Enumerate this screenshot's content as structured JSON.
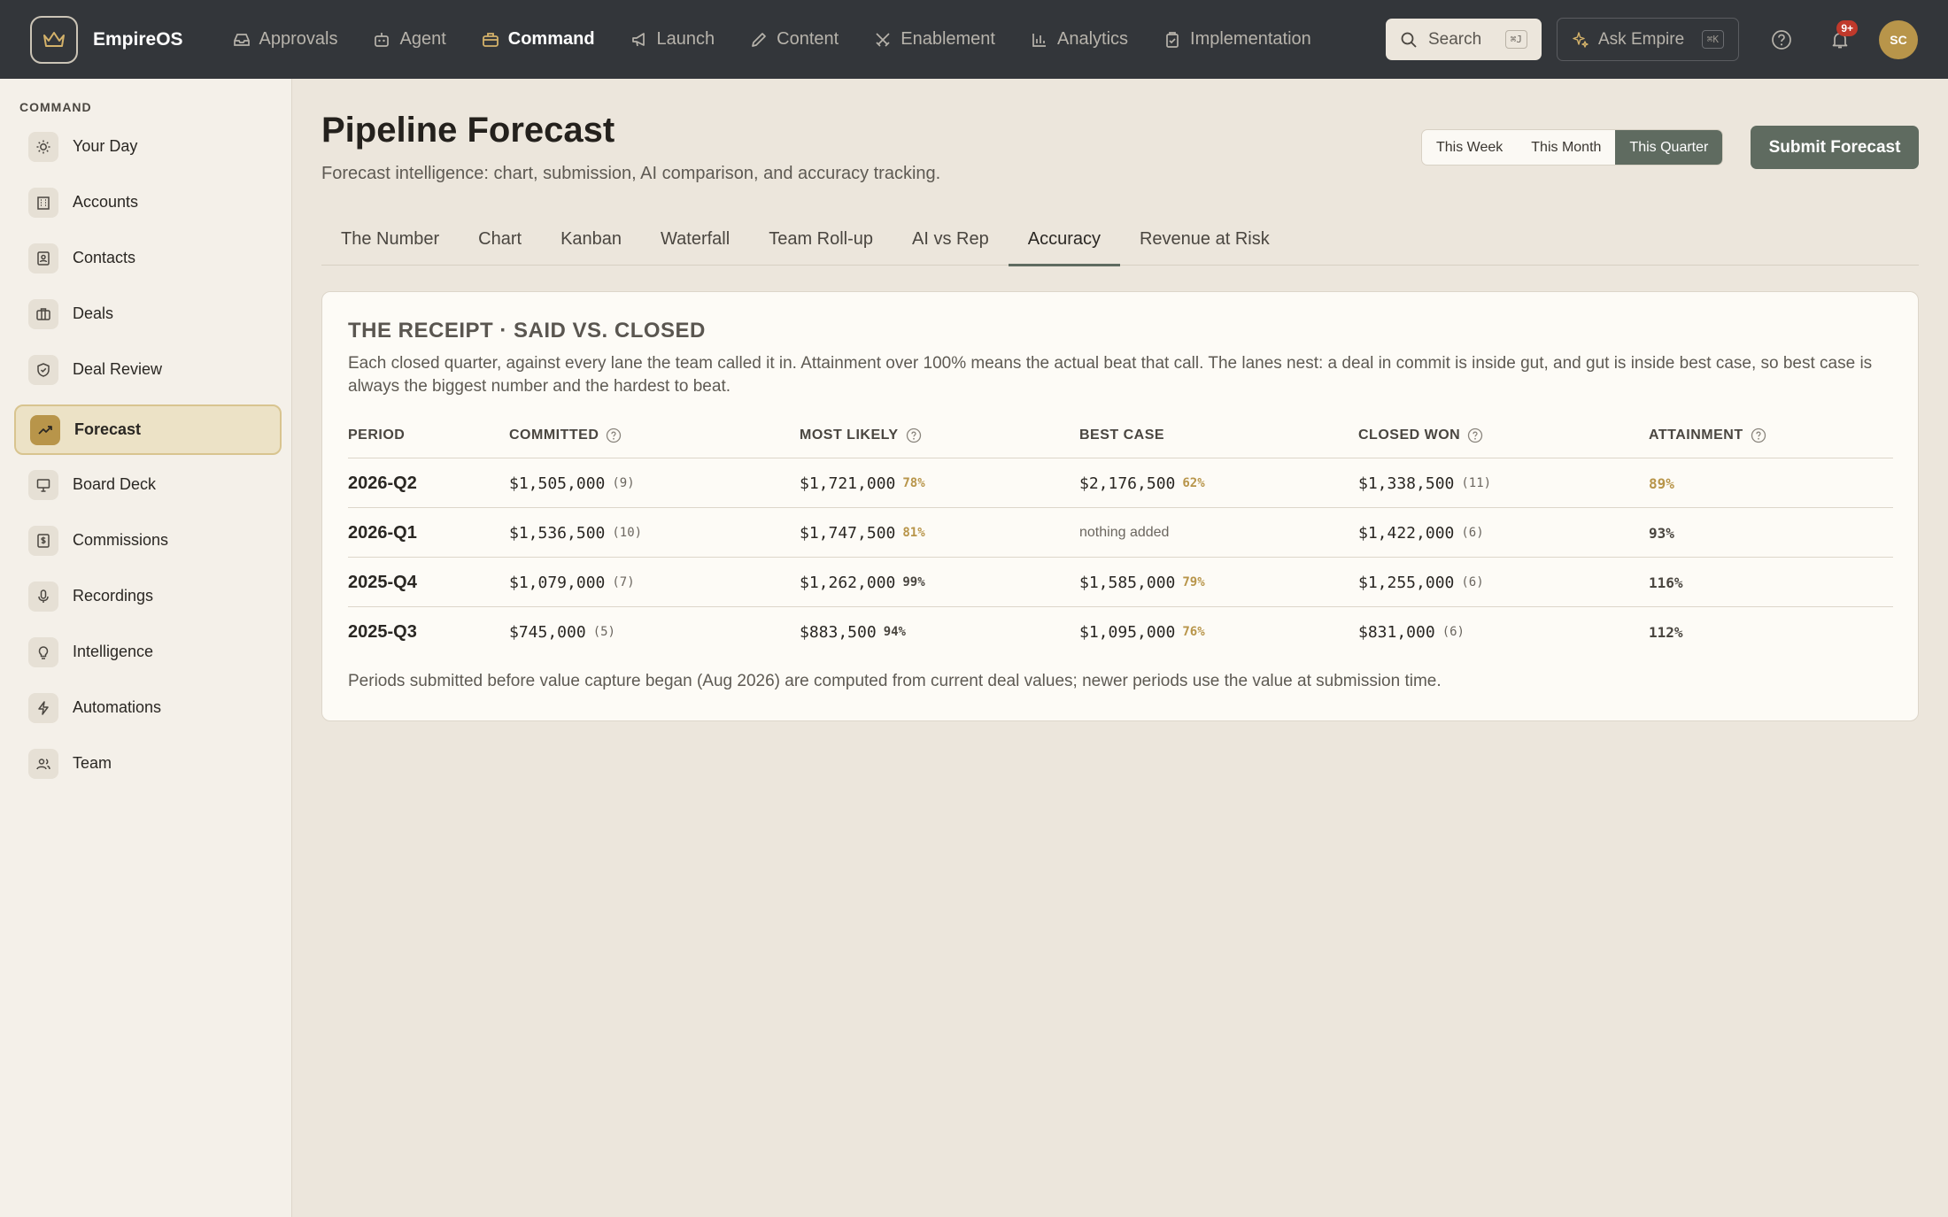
{
  "app": {
    "name": "EmpireOS"
  },
  "topnav": [
    {
      "label": "Approvals",
      "icon": "inbox-icon",
      "active": false
    },
    {
      "label": "Agent",
      "icon": "robot-icon",
      "active": false
    },
    {
      "label": "Command",
      "icon": "briefcase-icon",
      "active": true
    },
    {
      "label": "Launch",
      "icon": "megaphone-icon",
      "active": false
    },
    {
      "label": "Content",
      "icon": "pencil-icon",
      "active": false
    },
    {
      "label": "Enablement",
      "icon": "swords-icon",
      "active": false
    },
    {
      "label": "Analytics",
      "icon": "bar-chart-icon",
      "active": false
    },
    {
      "label": "Implementation",
      "icon": "clipboard-icon",
      "active": false
    }
  ],
  "search": {
    "label": "Search",
    "shortcut": "⌘J"
  },
  "ask": {
    "label": "Ask Empire",
    "shortcut": "⌘K"
  },
  "notifications": {
    "badge": "9+"
  },
  "user": {
    "initials": "SC"
  },
  "sidebar": {
    "section": "COMMAND",
    "items": [
      {
        "label": "Your Day",
        "icon": "sun-icon"
      },
      {
        "label": "Accounts",
        "icon": "building-icon"
      },
      {
        "label": "Contacts",
        "icon": "contact-card-icon"
      },
      {
        "label": "Deals",
        "icon": "briefcase-icon"
      },
      {
        "label": "Deal Review",
        "icon": "shield-check-icon"
      },
      {
        "label": "Forecast",
        "icon": "trending-up-icon"
      },
      {
        "label": "Board Deck",
        "icon": "presentation-icon"
      },
      {
        "label": "Commissions",
        "icon": "dollar-doc-icon"
      },
      {
        "label": "Recordings",
        "icon": "microphone-icon"
      },
      {
        "label": "Intelligence",
        "icon": "lightbulb-icon"
      },
      {
        "label": "Automations",
        "icon": "lightning-icon"
      },
      {
        "label": "Team",
        "icon": "users-icon"
      }
    ],
    "active_index": 5
  },
  "page": {
    "title": "Pipeline Forecast",
    "subtitle": "Forecast intelligence: chart, submission, AI comparison, and accuracy tracking.",
    "periods": [
      "This Week",
      "This Month",
      "This Quarter"
    ],
    "active_period": "This Quarter",
    "submit_label": "Submit Forecast"
  },
  "tabs": [
    "The Number",
    "Chart",
    "Kanban",
    "Waterfall",
    "Team Roll-up",
    "AI vs Rep",
    "Accuracy",
    "Revenue at Risk"
  ],
  "active_tab": "Accuracy",
  "receipt": {
    "title": "THE RECEIPT · SAID VS. CLOSED",
    "description": "Each closed quarter, against every lane the team called it in. Attainment over 100% means the actual beat that call. The lanes nest: a deal in commit is inside gut, and gut is inside best case, so best case is always the biggest number and the hardest to beat.",
    "columns": [
      "PERIOD",
      "COMMITTED",
      "MOST LIKELY",
      "BEST CASE",
      "CLOSED WON",
      "ATTAINMENT"
    ],
    "rows": [
      {
        "period": "2026-Q2",
        "committed": "$1,505,000",
        "committed_count": "(9)",
        "most_likely": "$1,721,000",
        "most_likely_pct": "78%",
        "best_case": "$2,176,500",
        "best_case_pct": "62%",
        "closed_won": "$1,338,500",
        "closed_won_count": "(11)",
        "attainment": "89%"
      },
      {
        "period": "2026-Q1",
        "committed": "$1,536,500",
        "committed_count": "(10)",
        "most_likely": "$1,747,500",
        "most_likely_pct": "81%",
        "best_case": "nothing added",
        "best_case_pct": "",
        "closed_won": "$1,422,000",
        "closed_won_count": "(6)",
        "attainment": "93%"
      },
      {
        "period": "2025-Q4",
        "committed": "$1,079,000",
        "committed_count": "(7)",
        "most_likely": "$1,262,000",
        "most_likely_pct": "99%",
        "best_case": "$1,585,000",
        "best_case_pct": "79%",
        "closed_won": "$1,255,000",
        "closed_won_count": "(6)",
        "attainment": "116%"
      },
      {
        "period": "2025-Q3",
        "committed": "$745,000",
        "committed_count": "(5)",
        "most_likely": "$883,500",
        "most_likely_pct": "94%",
        "best_case": "$1,095,000",
        "best_case_pct": "76%",
        "closed_won": "$831,000",
        "closed_won_count": "(6)",
        "attainment": "112%"
      }
    ],
    "footnote": "Periods submitted before value capture began (Aug 2026) are computed from current deal values; newer periods use the value at submission time."
  },
  "colors": {
    "accent_gold": "#b8954a",
    "primary_green": "#5f6b60",
    "topbar": "#33363a",
    "alert_red": "#c0392b"
  }
}
